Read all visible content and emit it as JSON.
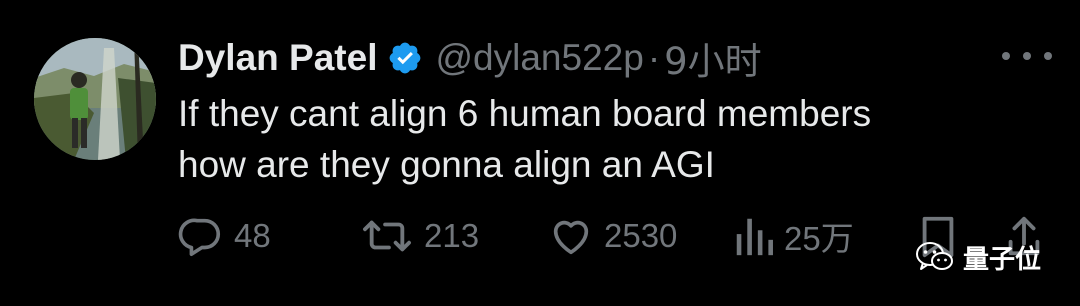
{
  "tweet": {
    "author_name": "Dylan Patel",
    "handle": "@dylan522p",
    "separator": "·",
    "time": "9小时",
    "text_lines": [
      "If they cant align 6 human board members",
      "how are they gonna align an AGI"
    ]
  },
  "actions": {
    "replies": "48",
    "retweets": "213",
    "likes": "2530",
    "views": "25万"
  },
  "watermark": {
    "label": "量子位"
  },
  "colors": {
    "background": "#000000",
    "text": "#e7e9ea",
    "muted": "#71767b",
    "verified": "#1d9bf0"
  }
}
